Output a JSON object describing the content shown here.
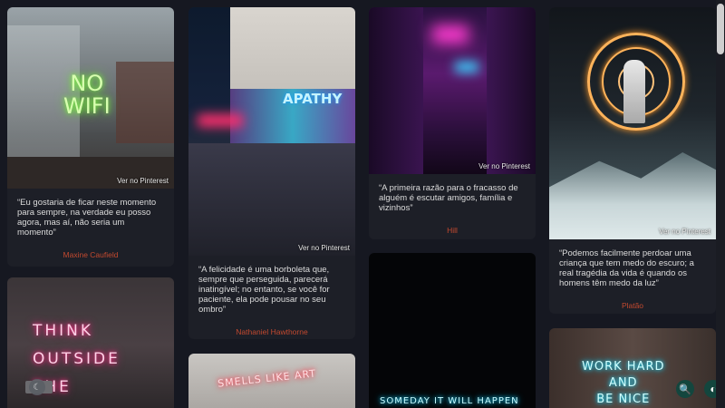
{
  "pin_label": "Ver no Pinterest",
  "cards": [
    {
      "neon": "NO\nWIFI",
      "quote": "“Eu gostaria de ficar neste momento para sempre, na verdade eu posso agora, mas aí, não seria um momento”",
      "author": "Maxine Caufield"
    },
    {
      "neon": "APATHY",
      "quote": "“A felicidade é uma borboleta que, sempre que perseguida, parecerá inatingível; no entanto, se você for paciente, ela pode pousar no seu ombro”",
      "author": "Nathaniel Hawthorne"
    },
    {
      "neon": "",
      "quote": "“A primeira razão para o fracasso de alguém é escutar amigos, família e vizinhos”",
      "author": "Hill"
    },
    {
      "neon": "",
      "quote": "“Podemos facilmente perdoar uma criança que tem medo do escuro; a real tragédia da vida é quando os homens têm medo da luz”",
      "author": "Platão"
    },
    {
      "neon": "THINK\nOUTSIDE\nTHE"
    },
    {
      "neon": "SMELLS LIKE ART"
    },
    {
      "neon": "SOMEDAY IT WILL HAPPEN"
    },
    {
      "neon": "WORK HARD\nAND\nBE NICE"
    }
  ]
}
